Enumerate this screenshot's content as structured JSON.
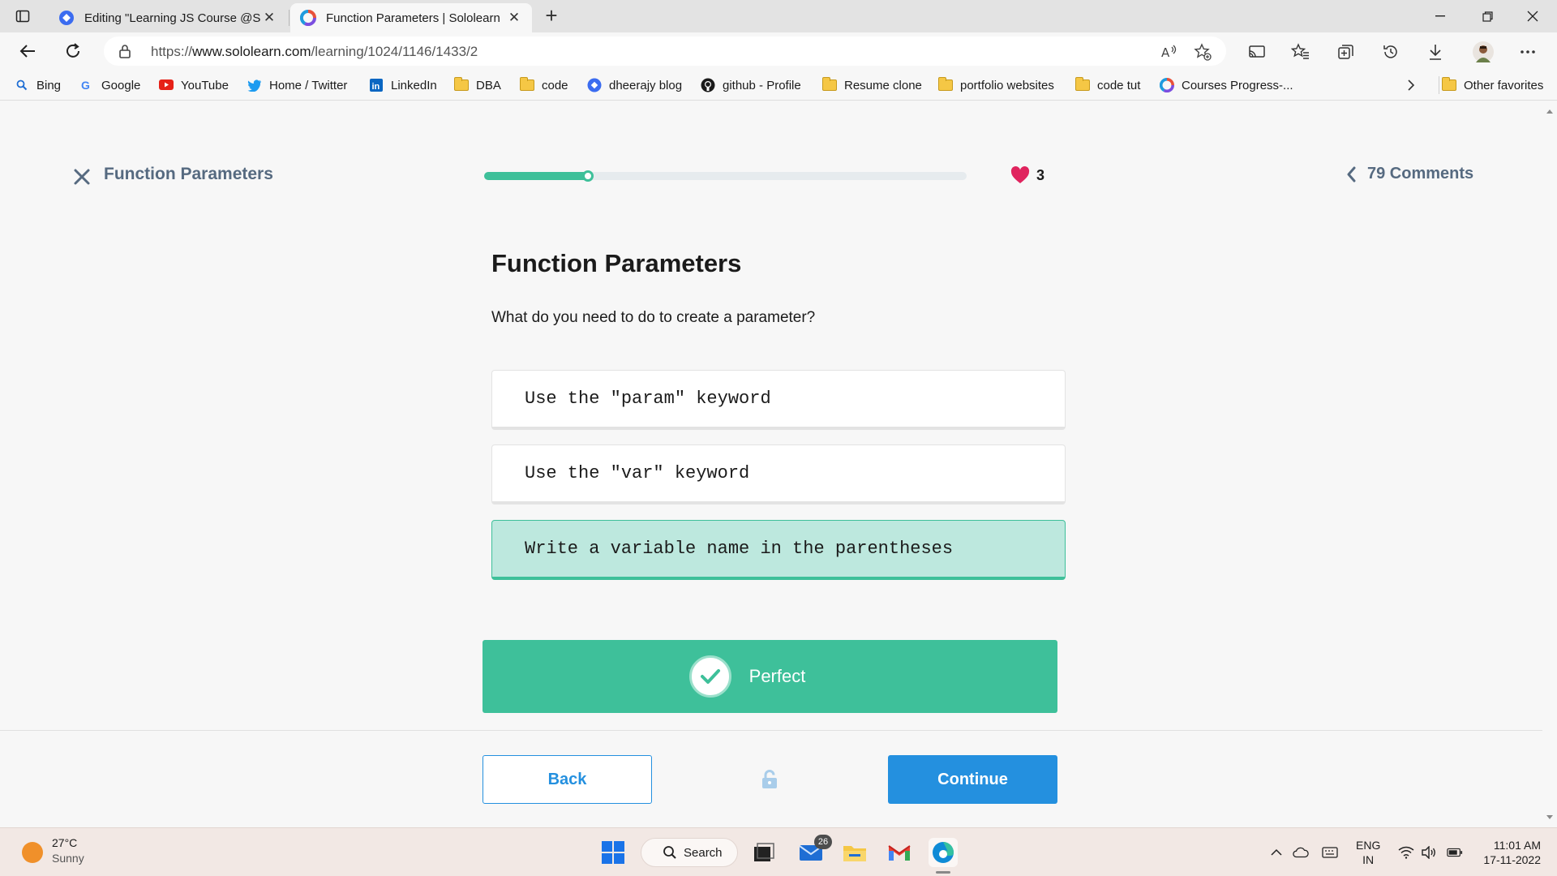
{
  "browser": {
    "tabs": [
      {
        "title": "Editing \"Learning JS Course @Sc",
        "active": false
      },
      {
        "title": "Function Parameters | Sololearn",
        "active": true
      }
    ],
    "address": {
      "protocol": "https://",
      "host": "www.sololearn.com",
      "path": "/learning/1024/1146/1433/2"
    },
    "bookmarks": [
      {
        "label": "Bing",
        "icon": "search-icon"
      },
      {
        "label": "Google",
        "icon": "google-icon"
      },
      {
        "label": "YouTube",
        "icon": "youtube-icon"
      },
      {
        "label": "Home / Twitter",
        "icon": "twitter-icon"
      },
      {
        "label": "LinkedIn",
        "icon": "linkedin-icon"
      },
      {
        "label": "DBA",
        "icon": "folder-icon"
      },
      {
        "label": "code",
        "icon": "folder-icon"
      },
      {
        "label": "dheerajy blog",
        "icon": "blog-icon"
      },
      {
        "label": "github - Profile",
        "icon": "github-icon"
      },
      {
        "label": "Resume clone",
        "icon": "folder-icon"
      },
      {
        "label": "portfolio websites",
        "icon": "folder-icon"
      },
      {
        "label": "code tut",
        "icon": "folder-icon"
      },
      {
        "label": "Courses Progress-...",
        "icon": "sololearn-icon"
      }
    ],
    "other_favorites": "Other favorites"
  },
  "lesson": {
    "title": "Function Parameters",
    "progress_fraction": 0.22,
    "hearts": "3",
    "comments": "79 Comments",
    "heading": "Function Parameters",
    "question": "What do you need to do to create a parameter?",
    "options": [
      {
        "text": "Use the \"param\" keyword",
        "selected": false
      },
      {
        "text": "Use the \"var\" keyword",
        "selected": false
      },
      {
        "text": "Write a variable name in the parentheses",
        "selected": true
      }
    ],
    "feedback": "Perfect",
    "back_label": "Back",
    "continue_label": "Continue"
  },
  "taskbar": {
    "temperature": "27°C",
    "condition": "Sunny",
    "search_label": "Search",
    "mail_badge": "26",
    "lang_top": "ENG",
    "lang_bottom": "IN",
    "time": "11:01 AM",
    "date": "17-11-2022"
  },
  "colors": {
    "accent_green": "#3ec09a",
    "accent_blue": "#2490df",
    "heart_red": "#e0245e",
    "muted_title": "#566a80"
  }
}
